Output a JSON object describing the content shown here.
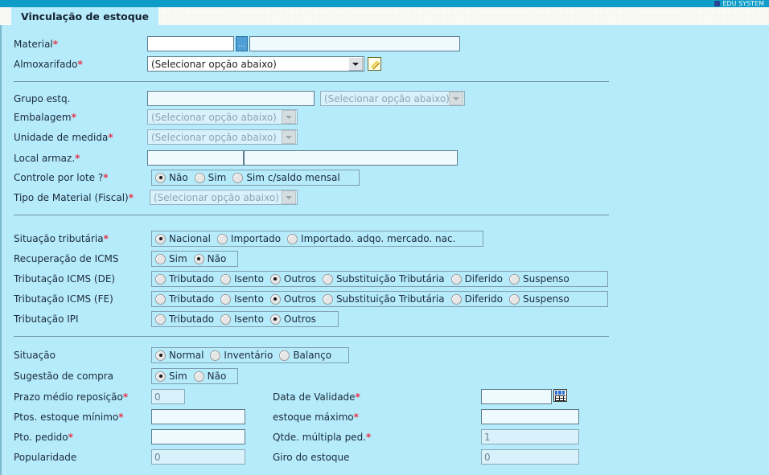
{
  "window": {
    "topbar_partial_text": "EDU SYSTEM",
    "tab_title": "Vinculação de estoque"
  },
  "common": {
    "select_placeholder": "(Selecionar opção abaixo)",
    "required_mark": "*",
    "lookup_label": "...",
    "pencil_icon": "pencil-icon",
    "calendar_icon": "calendar-icon"
  },
  "section1": {
    "material": {
      "label": "Material",
      "required": true,
      "code_value": "",
      "name_value": ""
    },
    "almoxarifado": {
      "label": "Almoxarifado",
      "required": true,
      "value": "(Selecionar opção abaixo)",
      "enabled": true
    }
  },
  "section2": {
    "grupo_estq": {
      "label": "Grupo estq.",
      "required": false,
      "text_value": "",
      "select_value": "(Selecionar opção abaixo)"
    },
    "embalagem": {
      "label": "Embalagem",
      "required": true,
      "value": "(Selecionar opção abaixo)"
    },
    "unidade_medida": {
      "label": "Unidade de medida",
      "required": true,
      "value": "(Selecionar opção abaixo)"
    },
    "local_armaz": {
      "label": "Local armaz.",
      "required": true,
      "code_value": "",
      "name_value": ""
    },
    "controle_lote": {
      "label": "Controle por lote ?",
      "required": true,
      "options": [
        "Não",
        "Sim",
        "Sim c/saldo mensal"
      ],
      "selected": "Não"
    },
    "tipo_material_fiscal": {
      "label": "Tipo de Material (Fiscal)",
      "required": true,
      "value": "(Selecionar opção abaixo)"
    }
  },
  "section3": {
    "situacao_tributaria": {
      "label": "Situação tributária",
      "required": true,
      "options": [
        "Nacional",
        "Importado",
        "Importado. adqo. mercado. nac."
      ],
      "selected": "Nacional"
    },
    "recuperacao_icms": {
      "label": "Recuperação de ICMS",
      "required": false,
      "options": [
        "Sim",
        "Não"
      ],
      "selected": "Não"
    },
    "tributacao_icms_de": {
      "label": "Tributação ICMS (DE)",
      "required": false,
      "options": [
        "Tributado",
        "Isento",
        "Outros",
        "Substituição Tributária",
        "Diferido",
        "Suspenso"
      ],
      "selected": "Outros"
    },
    "tributacao_icms_fe": {
      "label": "Tributação ICMS (FE)",
      "required": false,
      "options": [
        "Tributado",
        "Isento",
        "Outros",
        "Substituição Tributária",
        "Diferido",
        "Suspenso"
      ],
      "selected": "Outros"
    },
    "tributacao_ipi": {
      "label": "Tributação IPI",
      "required": false,
      "options": [
        "Tributado",
        "Isento",
        "Outros"
      ],
      "selected": "Outros"
    }
  },
  "section4": {
    "situacao": {
      "label": "Situação",
      "required": false,
      "options": [
        "Normal",
        "Inventário",
        "Balanço"
      ],
      "selected": "Normal"
    },
    "sugestao_compra": {
      "label": "Sugestão de compra",
      "required": false,
      "options": [
        "Sim",
        "Não"
      ],
      "selected": "Sim"
    },
    "prazo_medio_reposicao": {
      "label": "Prazo médio reposição",
      "required": true,
      "value": "0"
    },
    "data_validade": {
      "label": "Data de Validade",
      "required": true,
      "value": ""
    },
    "ptos_estoque_minimo": {
      "label": "Ptos. estoque mínimo",
      "required": true,
      "value": ""
    },
    "estoque_maximo": {
      "label": "estoque máximo",
      "required": true,
      "value": ""
    },
    "pto_pedido": {
      "label": "Pto. pedido",
      "required": true,
      "value": ""
    },
    "qtde_multipla_ped": {
      "label": "Qtde. múltipla ped.",
      "required": true,
      "value": "1"
    },
    "popularidade": {
      "label": "Popularidade",
      "required": false,
      "value": "0"
    },
    "giro_estoque": {
      "label": "Giro do estoque",
      "required": false,
      "value": "0"
    }
  }
}
